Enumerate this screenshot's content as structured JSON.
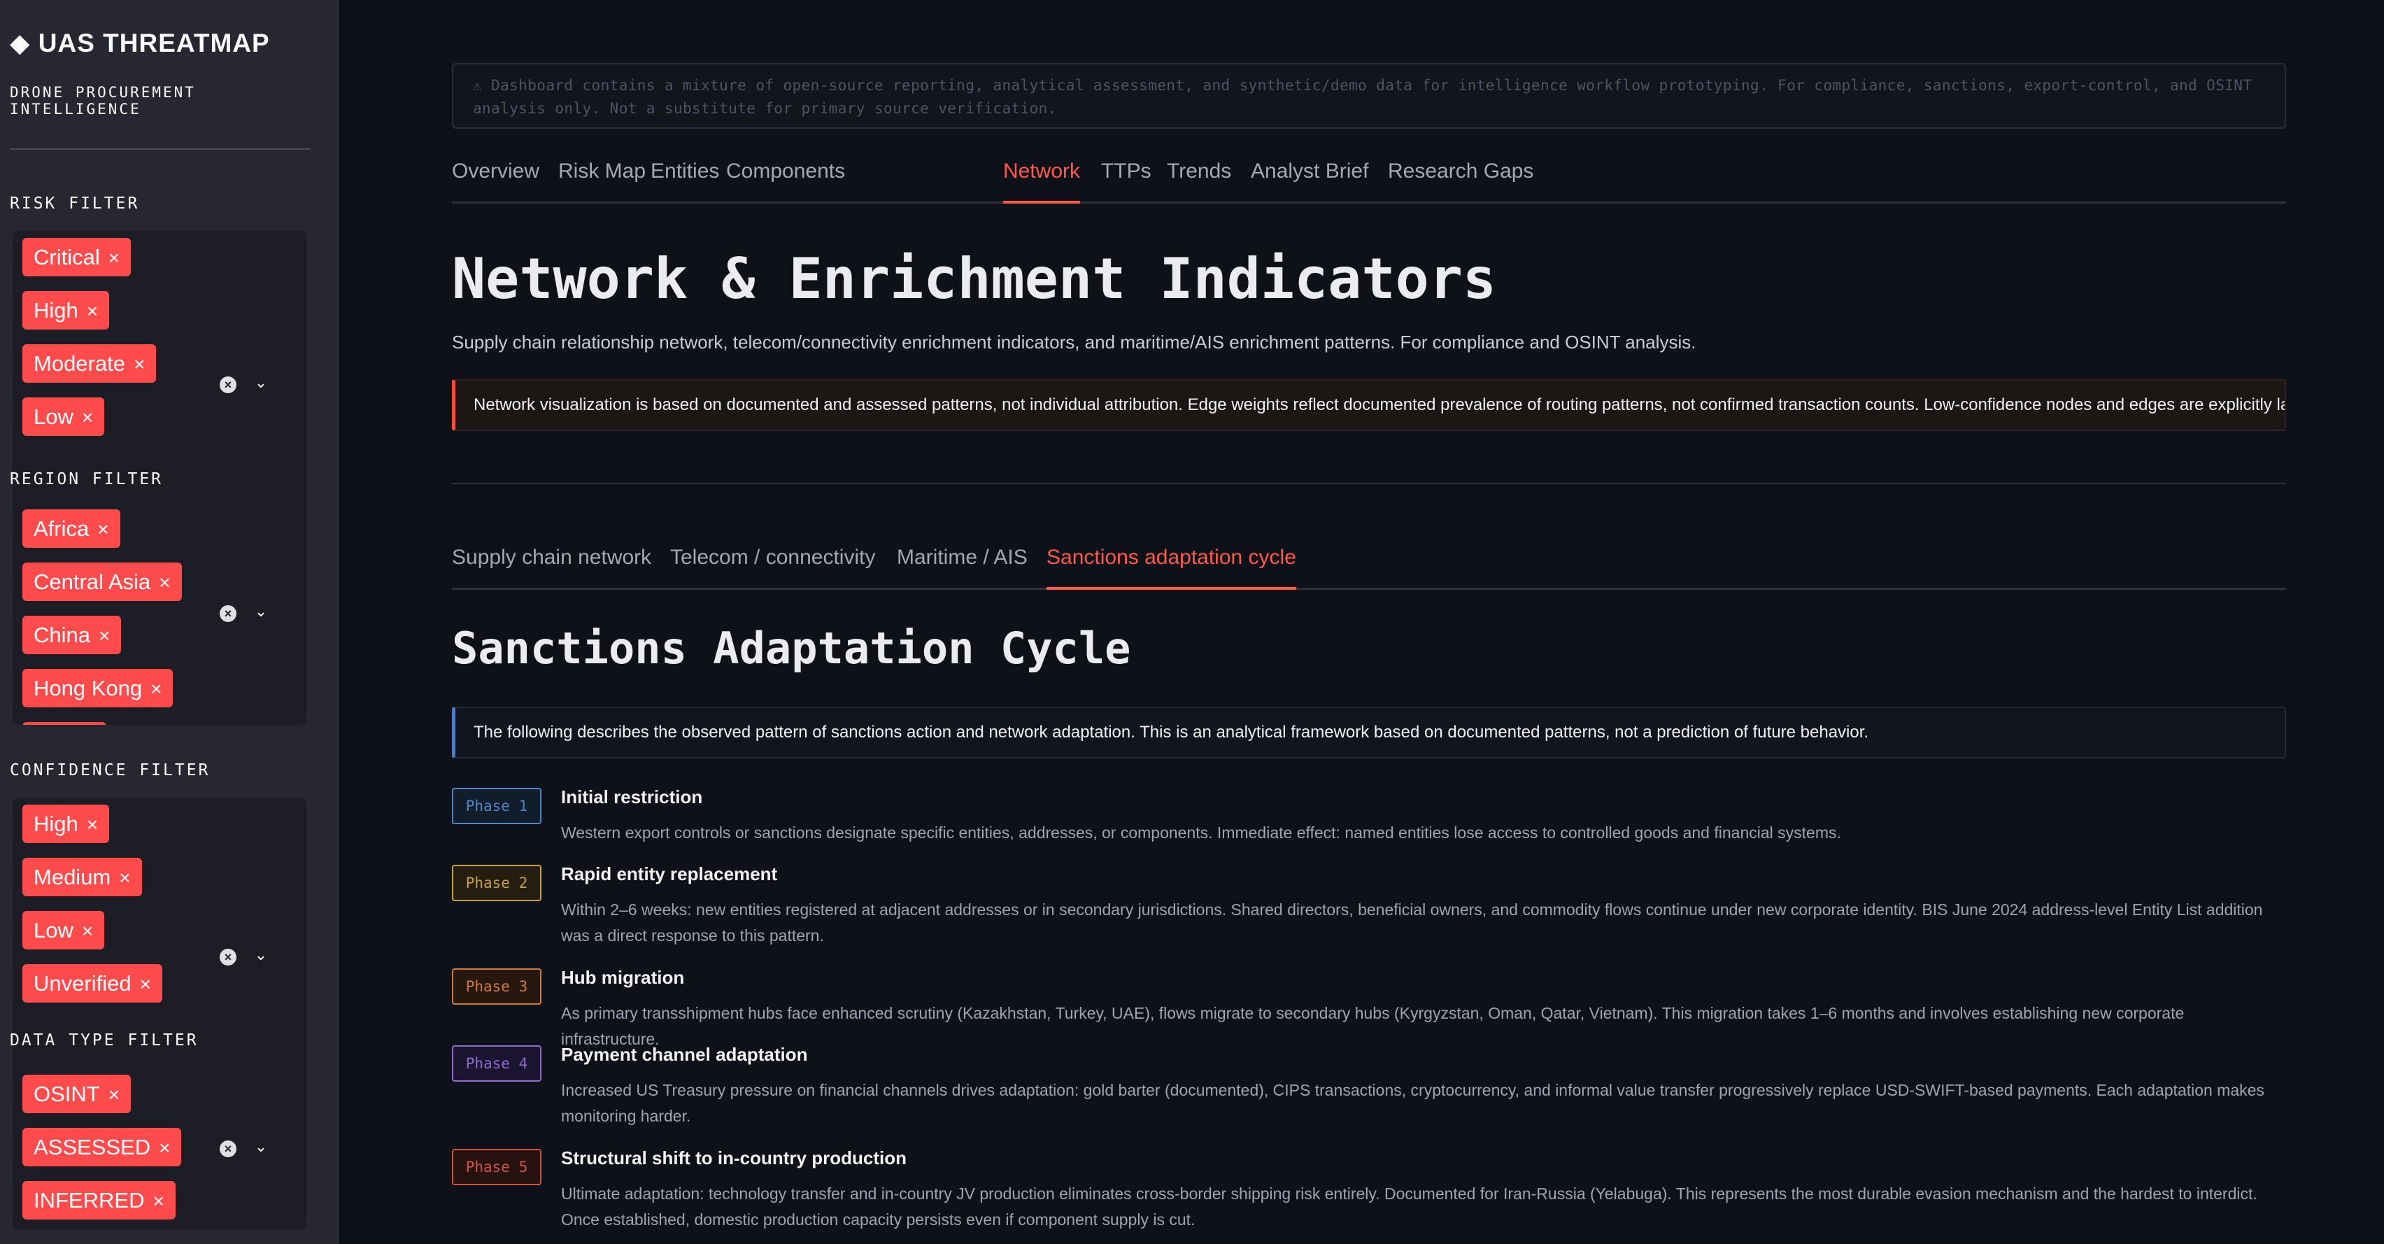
{
  "sidebar": {
    "title_icon": "◆",
    "title": "UAS THREATMAP",
    "subtitle": "DRONE PROCUREMENT INTELLIGENCE",
    "filters": [
      {
        "label": "RISK FILTER",
        "tags": [
          "Critical",
          "High",
          "Moderate",
          "Low"
        ]
      },
      {
        "label": "REGION FILTER",
        "tags": [
          "Africa",
          "Central Asia",
          "China",
          "Hong Kong"
        ]
      },
      {
        "label": "CONFIDENCE FILTER",
        "tags": [
          "High",
          "Medium",
          "Low",
          "Unverified"
        ]
      },
      {
        "label": "DATA TYPE FILTER",
        "tags": [
          "OSINT",
          "ASSESSED",
          "INFERRED"
        ]
      }
    ],
    "tag_remove_glyph": "×",
    "clear_glyph": "×",
    "chevron_glyph": "⌄"
  },
  "disclaimer": "⚠ Dashboard contains a mixture of open-source reporting, analytical assessment, and synthetic/demo data for intelligence workflow prototyping. For compliance, sanctions, export-control, and OSINT analysis only. Not a substitute for primary source verification.",
  "nav": {
    "tabs": [
      "Overview",
      "Risk Map",
      "Entities",
      "Components",
      "Network",
      "TTPs",
      "Trends",
      "Analyst Brief",
      "Research Gaps"
    ],
    "active": "Network"
  },
  "page": {
    "title": "Network & Enrichment Indicators",
    "description": "Supply chain relationship network, telecom/connectivity enrichment indicators, and maritime/AIS enrichment patterns. For compliance and OSINT analysis.",
    "warning": "Network visualization is based on documented and assessed patterns, not individual attribution. Edge weights reflect documented prevalence of routing patterns, not confirmed transaction counts. Low-confidence nodes and edges are explicitly labeled."
  },
  "subnav": {
    "tabs": [
      "Supply chain network",
      "Telecom / connectivity",
      "Maritime / AIS",
      "Sanctions adaptation cycle"
    ],
    "active": "Sanctions adaptation cycle"
  },
  "section": {
    "title": "Sanctions Adaptation Cycle",
    "info": "The following describes the observed pattern of sanctions action and network adaptation. This is an analytical framework based on documented patterns, not a prediction of future behavior."
  },
  "phases": [
    {
      "badge": "Phase 1",
      "title": "Initial restriction",
      "text": "Western export controls or sanctions designate specific entities, addresses, or components. Immediate effect: named entities lose access to controlled goods and financial systems.",
      "color": "#4f86c6",
      "bg": "#121d2c"
    },
    {
      "badge": "Phase 2",
      "title": "Rapid entity replacement",
      "text": "Within 2–6 weeks: new entities registered at adjacent addresses or in secondary jurisdictions. Shared directors, beneficial owners, and commodity flows continue under new corporate identity. BIS June 2024 address-level Entity List addition was a direct response to this pattern.",
      "color": "#c9a23a",
      "bg": "#241e10"
    },
    {
      "badge": "Phase 3",
      "title": "Hub migration",
      "text": "As primary transshipment hubs face enhanced scrutiny (Kazakhstan, Turkey, UAE), flows migrate to secondary hubs (Kyrgyzstan, Oman, Qatar, Vietnam). This migration takes 1–6 months and involves establishing new corporate infrastructure.",
      "color": "#d27a3c",
      "bg": "#26180f"
    },
    {
      "badge": "Phase 4",
      "title": "Payment channel adaptation",
      "text": "Increased US Treasury pressure on financial channels drives adaptation: gold barter (documented), CIPS transactions, cryptocurrency, and informal value transfer progressively replace USD-SWIFT-based payments. Each adaptation makes monitoring harder.",
      "color": "#8e6ad0",
      "bg": "#1c1530"
    },
    {
      "badge": "Phase 5",
      "title": "Structural shift to in-country production",
      "text": "Ultimate adaptation: technology transfer and in-country JV production eliminates cross-border shipping risk entirely. Documented for Iran-Russia (Yelabuga). This represents the most durable evasion mechanism and the hardest to interdict. Once established, domestic production capacity persists even if component supply is cut.",
      "color": "#d0543d",
      "bg": "#26120f"
    }
  ]
}
